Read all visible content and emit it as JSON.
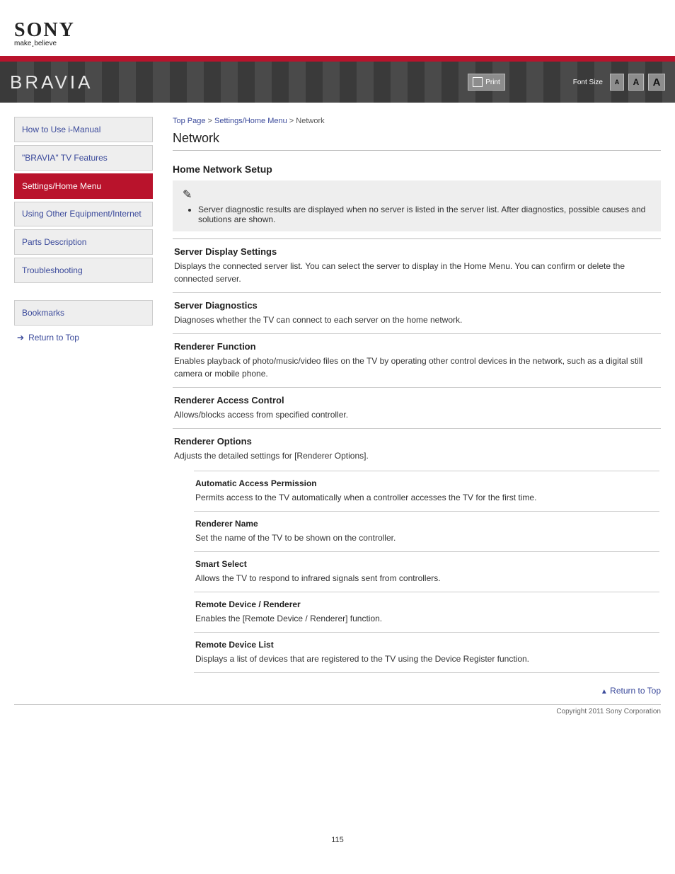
{
  "logo": {
    "brand": "SONY",
    "tagline_a": "make",
    "tagline_b": "believe"
  },
  "header": {
    "brand": "BRAVIA",
    "print": "Print",
    "font_label": "Font Size",
    "font_a": "A"
  },
  "breadcrumb": {
    "top": "Top Page",
    "sep": " > ",
    "cat": "Settings/Home Menu",
    "current": "Network"
  },
  "title": "Network",
  "nav": {
    "items": [
      "How to Use i-Manual",
      "\"BRAVIA\" TV Features",
      "Settings/Home Menu",
      "Using Other Equipment/Internet",
      "Parts Description",
      "Troubleshooting",
      "Bookmarks"
    ]
  },
  "trademark": "Return to Top",
  "section_heading": "Home Network Setup",
  "notice": "Server diagnostic results are displayed when no server is listed in the server list. After diagnostics, possible causes and solutions are shown.",
  "settings": [
    {
      "name": "Server Display Settings",
      "desc": "Displays the connected server list. You can select the server to display in the Home Menu. You can confirm or delete the connected server."
    },
    {
      "name": "Server Diagnostics",
      "desc": "Diagnoses whether the TV can connect to each server on the home network."
    },
    {
      "name": "Renderer Function",
      "desc": "Enables playback of photo/music/video files on the TV by operating other control devices in the network, such as a digital still camera or mobile phone."
    },
    {
      "name": "Renderer Access Control",
      "desc": "Allows/blocks access from specified controller."
    },
    {
      "name": "Renderer Options",
      "desc": "Adjusts the detailed settings for [Renderer Options].",
      "sub": [
        {
          "name": "Automatic Access Permission",
          "desc": "Permits access to the TV automatically when a controller accesses the TV for the first time."
        },
        {
          "name": "Renderer Name",
          "desc": "Set the name of the TV to be shown on the controller."
        },
        {
          "name": "Smart Select",
          "desc": "Allows the TV to respond to infrared signals sent from controllers."
        },
        {
          "name": "Remote Device / Renderer",
          "desc": "Enables the [Remote Device / Renderer] function."
        },
        {
          "name": "Remote Device List",
          "desc": "Displays a list of devices that are registered to the TV using the Device Register function."
        }
      ]
    }
  ],
  "top_link": "Return to Top",
  "copyright": "Copyright 2011 Sony Corporation",
  "page_number": "115"
}
